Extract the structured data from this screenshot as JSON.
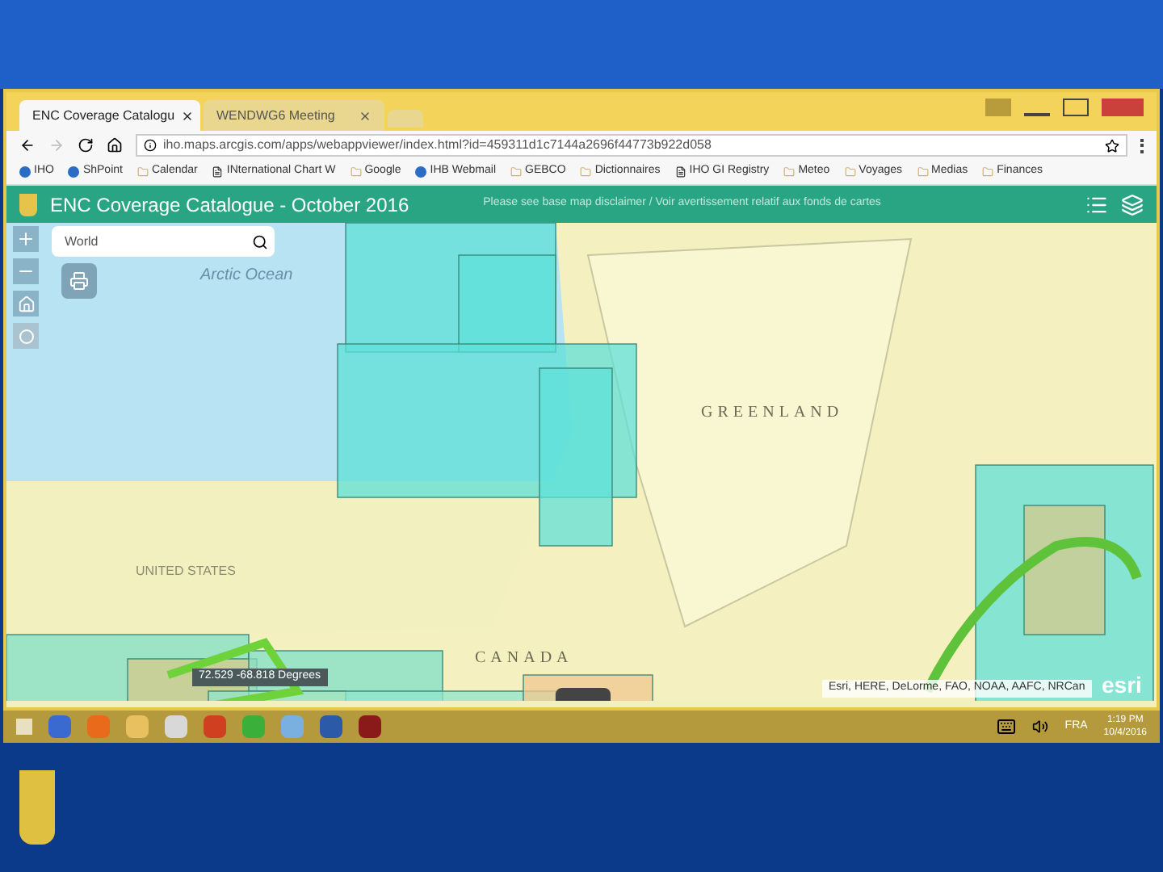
{
  "browser": {
    "tabs": [
      {
        "label": "ENC Coverage Catalogu",
        "selected": true
      },
      {
        "label": "WENDWG6 Meeting",
        "selected": false
      }
    ],
    "url": "iho.maps.arcgis.com/apps/webappviewer/index.html?id=459311d1c7144a2696f44773b922d058",
    "bookmarks": [
      {
        "label": "IHO"
      },
      {
        "label": "ShPoint"
      },
      {
        "label": "Calendar"
      },
      {
        "label": "INternational Chart W"
      },
      {
        "label": "Google"
      },
      {
        "label": "IHB Webmail"
      },
      {
        "label": "GEBCO"
      },
      {
        "label": "Dictionnaires"
      },
      {
        "label": "IHO GI Registry"
      },
      {
        "label": "Meteo"
      },
      {
        "label": "Voyages"
      },
      {
        "label": "Medias"
      },
      {
        "label": "Finances"
      }
    ]
  },
  "app": {
    "title": "ENC Coverage Catalogue - October 2016",
    "disclaimer": "Please see base map disclaimer / Voir avertissement relatif aux fonds de cartes",
    "search": {
      "value": "World"
    },
    "map_labels": [
      "Arctic Ocean",
      "UNITED STATES",
      "GREENLAND",
      "CANADA"
    ],
    "coordinates": "72.529 -68.818 Degrees",
    "attribution": "Esri, HERE, DeLorme, FAO, NOAA, AAFC, NRCan",
    "logo": "esri"
  },
  "taskbar": {
    "tray_lang": "FRA",
    "time": "1:19 PM",
    "date": "10/4/2016"
  }
}
